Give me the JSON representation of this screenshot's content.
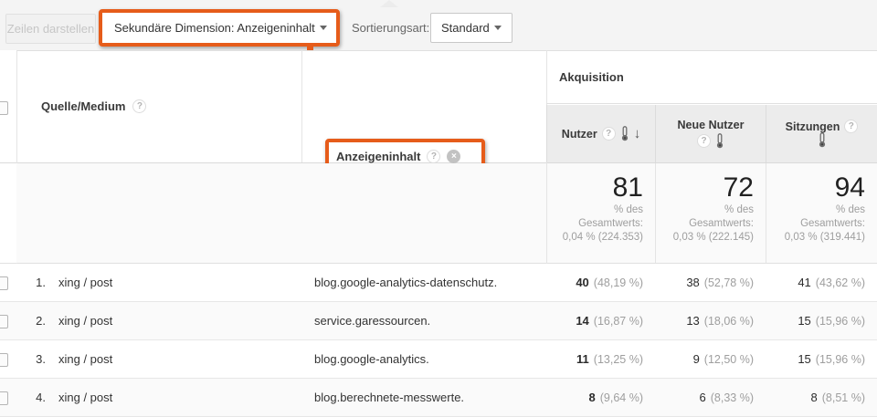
{
  "icons": {
    "help": "?",
    "close": "×",
    "sort_desc": "↓"
  },
  "toolbar": {
    "show_rows_label": "Zeilen darstellen",
    "secondary_dimension_label": "Sekundäre Dimension: Anzeigeninhalt",
    "sort_label": "Sortierungsart:",
    "sort_value": "Standard"
  },
  "colors": {
    "annotation_orange": "#e65c1a",
    "metric_header_bg": "#ececec"
  },
  "table": {
    "dimension_columns": {
      "source_medium": "Quelle/Medium",
      "ad_content": "Anzeigeninhalt"
    },
    "group_header": "Akquisition",
    "metric_columns": {
      "users": "Nutzer",
      "new_users": "Neue Nutzer",
      "sessions": "Sitzungen"
    },
    "summary": {
      "users": {
        "value": "81",
        "line1": "% des",
        "line2": "Gesamtwerts:",
        "line3": "0,04 % (224.353)"
      },
      "new_users": {
        "value": "72",
        "line1": "% des",
        "line2": "Gesamtwerts:",
        "line3": "0,03 % (222.145)"
      },
      "sessions": {
        "value": "94",
        "line1": "% des",
        "line2": "Gesamtwerts:",
        "line3": "0,03 % (319.441)"
      }
    },
    "rows": [
      {
        "index": "1.",
        "source": "xing / post",
        "ad_content": "blog.google-analytics-datenschutz.",
        "users": "40",
        "users_pct": "(48,19 %)",
        "new_users": "38",
        "new_users_pct": "(52,78 %)",
        "sessions": "41",
        "sessions_pct": "(43,62 %)"
      },
      {
        "index": "2.",
        "source": "xing / post",
        "ad_content": "service.garessourcen.",
        "users": "14",
        "users_pct": "(16,87 %)",
        "new_users": "13",
        "new_users_pct": "(18,06 %)",
        "sessions": "15",
        "sessions_pct": "(15,96 %)"
      },
      {
        "index": "3.",
        "source": "xing / post",
        "ad_content": "blog.google-analytics.",
        "users": "11",
        "users_pct": "(13,25 %)",
        "new_users": "9",
        "new_users_pct": "(12,50 %)",
        "sessions": "15",
        "sessions_pct": "(15,96 %)"
      },
      {
        "index": "4.",
        "source": "xing / post",
        "ad_content": "blog.berechnete-messwerte.",
        "users": "8",
        "users_pct": "(9,64 %)",
        "new_users": "6",
        "new_users_pct": "(8,33 %)",
        "sessions": "8",
        "sessions_pct": "(8,51 %)"
      }
    ]
  }
}
